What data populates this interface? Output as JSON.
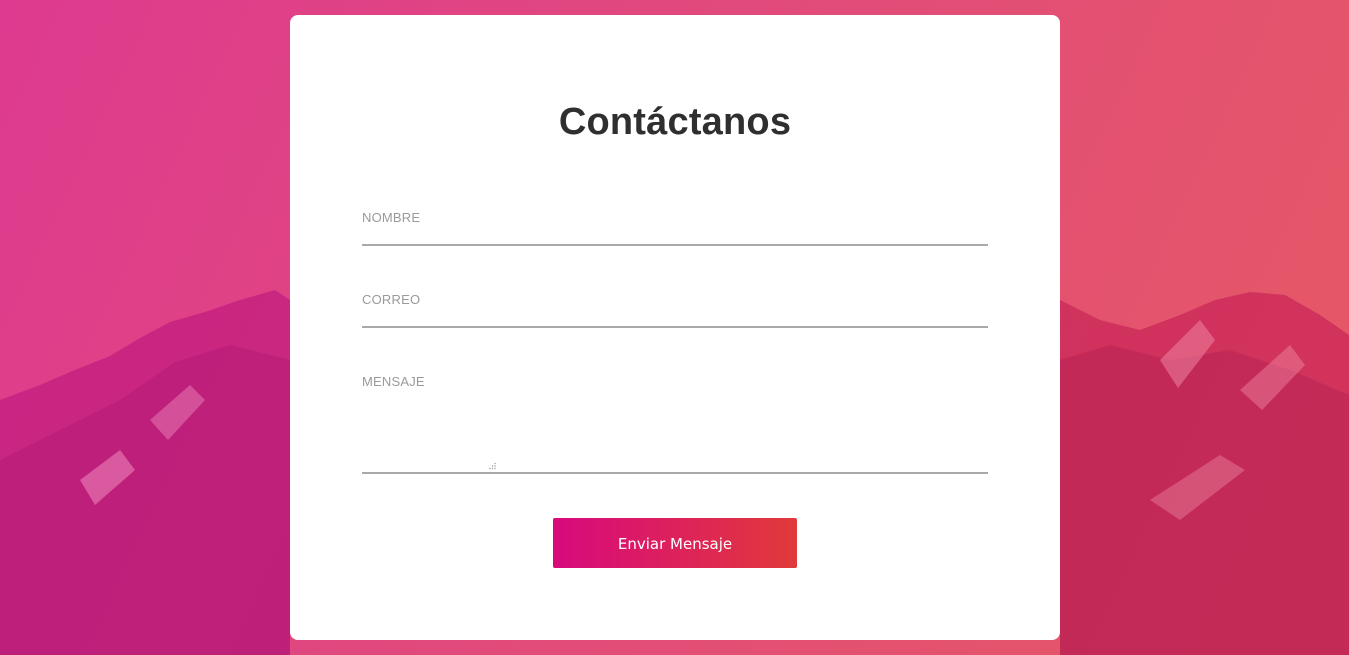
{
  "page": {
    "title": "Contáctanos"
  },
  "form": {
    "name_label": "NOMBRE",
    "email_label": "CORREO",
    "message_label": "MENSAJE",
    "submit_label": "Enviar Mensaje"
  },
  "colors": {
    "background_gradient_start": "#de3a8f",
    "background_gradient_end": "#e65a63",
    "button_gradient_start": "#d8097d",
    "button_gradient_end": "#e13a3a",
    "title_text": "#2f2f2f",
    "label_text": "#9a9a9a",
    "underline": "#a9a9a9"
  }
}
